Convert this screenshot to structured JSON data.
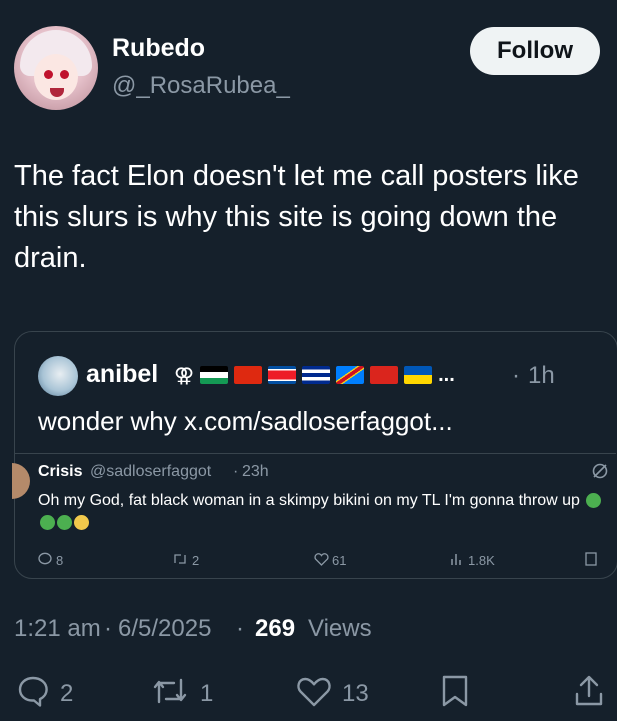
{
  "author": {
    "display_name": "Rubedo",
    "handle": "@_RosaRubea_",
    "follow_label": "Follow"
  },
  "tweet": {
    "text": "The fact Elon doesn't let me call posters like this slurs is why this site is going down the drain."
  },
  "quote": {
    "name": "anibel",
    "badges_text": "⚢",
    "ellipsis": "...",
    "dot": "·",
    "time": "1h",
    "text": "wonder why x.com/sadloserfaggot...",
    "flags": [
      "palestine",
      "china",
      "north-korea",
      "cuba",
      "dr-congo",
      "vietnam",
      "ukraine"
    ]
  },
  "inner_tweet": {
    "name": "Crisis",
    "handle": "@sadloserfaggot",
    "dot": "·",
    "time": "23h",
    "text": "Oh my God, fat black woman in a skimpy bikini on my TL I'm gonna throw up",
    "replies": "8",
    "reposts": "2",
    "likes": "61",
    "views": "1.8K"
  },
  "meta": {
    "time": "1:21 am",
    "dot": "·",
    "date": "6/5/2025",
    "views_count": "269",
    "views_label": "Views"
  },
  "actions": {
    "replies": "2",
    "reposts": "1",
    "likes": "13"
  },
  "colors": {
    "background": "#15202b",
    "secondary_text": "#8b98a5",
    "border": "#38444d",
    "follow_bg": "#eff3f4"
  }
}
